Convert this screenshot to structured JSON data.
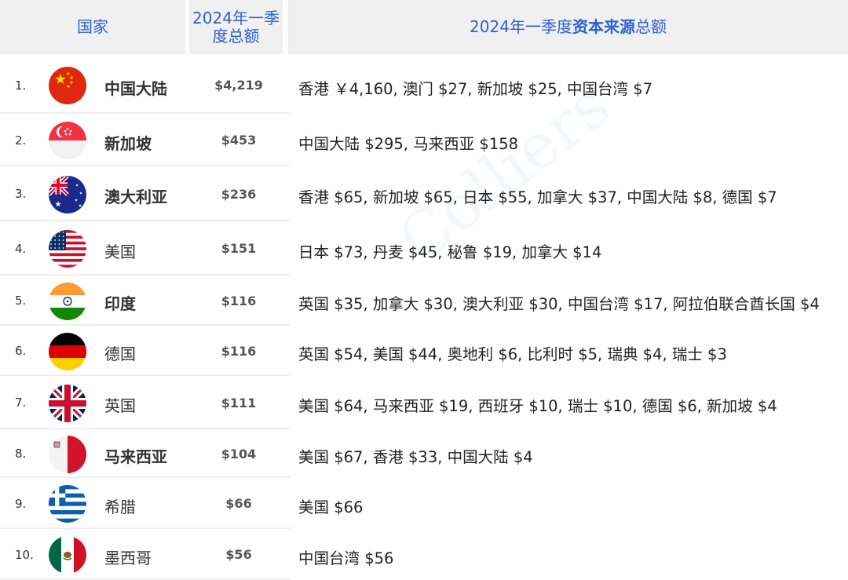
{
  "header": {
    "country": "国家",
    "total": "2024年一季度总额",
    "sources_prefix": "2024年一季度",
    "sources_bold": "资本来源",
    "sources_suffix": "总额"
  },
  "watermark": "Colliers",
  "colors": {
    "header_bg": "#f0f0f0",
    "header_text": "#2f5fd0",
    "separator": "#eeeeee"
  },
  "rows": [
    {
      "rank": "1.",
      "country": "中国大陆",
      "bold": true,
      "flag": "china-flag-icon",
      "total": "$4,219",
      "sources": "香港 ￥4,160, 澳门 $27, 新加坡 $25, 中国台湾 $7"
    },
    {
      "rank": "2.",
      "country": "新加坡",
      "bold": true,
      "flag": "singapore-flag-icon",
      "total": "$453",
      "sources": "中国大陆 $295, 马来西亚 $158"
    },
    {
      "rank": "3.",
      "country": "澳大利亚",
      "bold": true,
      "flag": "australia-flag-icon",
      "total": "$236",
      "sources": "香港 $65, 新加坡 $65, 日本 $55, 加拿大 $37, 中国大陆 $8, 德国 $7"
    },
    {
      "rank": "4.",
      "country": "美国",
      "bold": false,
      "flag": "usa-flag-icon",
      "total": "$151",
      "sources": "日本 $73, 丹麦 $45, 秘鲁 $19, 加拿大 $14"
    },
    {
      "rank": "5.",
      "country": "印度",
      "bold": true,
      "flag": "india-flag-icon",
      "total": "$116",
      "sources": "英国 $35, 加拿大 $30, 澳大利亚 $30, 中国台湾 $17, 阿拉伯联合酋长国 $4"
    },
    {
      "rank": "6.",
      "country": "德国",
      "bold": false,
      "flag": "germany-flag-icon",
      "total": "$116",
      "sources": "英国 $54, 美国 $44, 奥地利 $6, 比利时 $5, 瑞典 $4, 瑞士 $3"
    },
    {
      "rank": "7.",
      "country": "英国",
      "bold": false,
      "flag": "uk-flag-icon",
      "total": "$111",
      "sources": "美国 $64, 马来西亚 $19, 西班牙 $10, 瑞士 $10, 德国 $6, 新加坡 $4"
    },
    {
      "rank": "8.",
      "country": "马来西亚",
      "bold": true,
      "flag": "malta-flag-icon",
      "total": "$104",
      "sources": "美国 $67, 香港 $33, 中国大陆 $4"
    },
    {
      "rank": "9.",
      "country": "希腊",
      "bold": false,
      "flag": "greece-flag-icon",
      "total": "$66",
      "sources": "美国 $66"
    },
    {
      "rank": "10.",
      "country": "墨西哥",
      "bold": false,
      "flag": "mexico-flag-icon",
      "total": "$56",
      "sources": "中国台湾 $56"
    }
  ],
  "chart_data": {
    "type": "table",
    "columns": [
      "国家",
      "2024年一季度总额",
      "2024年一季度资本来源总额"
    ],
    "rows": [
      [
        "1.",
        "中国大陆",
        "$4,219",
        "香港 ￥4,160, 澳门 $27, 新加坡 $25, 中国台湾 $7"
      ],
      [
        "2.",
        "新加坡",
        "$453",
        "中国大陆 $295, 马来西亚 $158"
      ],
      [
        "3.",
        "澳大利亚",
        "$236",
        "香港 $65, 新加坡 $65, 日本 $55, 加拿大 $37, 中国大陆 $8, 德国 $7"
      ],
      [
        "4.",
        "美国",
        "$151",
        "日本 $73, 丹麦 $45, 秘鲁 $19, 加拿大 $14"
      ],
      [
        "5.",
        "印度",
        "$116",
        "英国 $35, 加拿大 $30, 澳大利亚 $30, 中国台湾 $17, 阿拉伯联合酋长国 $4"
      ],
      [
        "6.",
        "德国",
        "$116",
        "英国 $54, 美国 $44, 奥地利 $6, 比利时 $5, 瑞典 $4, 瑞士 $3"
      ],
      [
        "7.",
        "英国",
        "$111",
        "美国 $64, 马来西亚 $19, 西班牙 $10, 瑞士 $10, 德国 $6, 新加坡 $4"
      ],
      [
        "8.",
        "马来西亚",
        "$104",
        "美国 $67, 香港 $33, 中国大陆 $4"
      ],
      [
        "9.",
        "希腊",
        "$66",
        "美国 $66"
      ],
      [
        "10.",
        "墨西哥",
        "$56",
        "中国台湾 $56"
      ]
    ]
  }
}
